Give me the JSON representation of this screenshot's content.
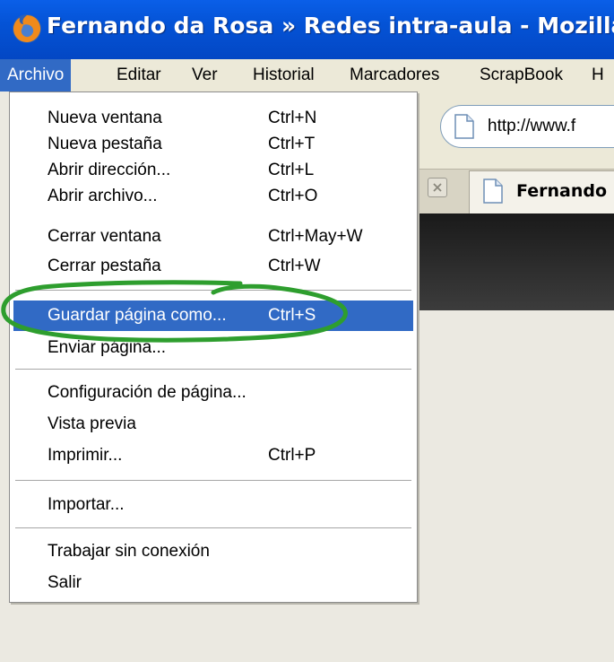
{
  "window": {
    "title": "Fernando da Rosa » Redes intra-aula - Mozilla Firef",
    "app_icon": "firefox-icon"
  },
  "menubar": {
    "items": [
      {
        "label": "Archivo",
        "active": true
      },
      {
        "label": "Editar"
      },
      {
        "label": "Ver"
      },
      {
        "label": "Historial"
      },
      {
        "label": "Marcadores"
      },
      {
        "label": "ScrapBook"
      },
      {
        "label": "H"
      }
    ]
  },
  "toolbar": {
    "url": "http://www.f",
    "page_icon": "page-icon"
  },
  "tabs": [
    {
      "label": "Fernando",
      "close_icon": "close-icon"
    }
  ],
  "archivo_menu": {
    "items": [
      {
        "label": "Nueva ventana",
        "shortcut": "Ctrl+N"
      },
      {
        "label": "Nueva pestaña",
        "shortcut": "Ctrl+T"
      },
      {
        "label": "Abrir dirección...",
        "shortcut": "Ctrl+L"
      },
      {
        "label": "Abrir archivo...",
        "shortcut": "Ctrl+O"
      },
      {
        "label": "Cerrar ventana",
        "shortcut": "Ctrl+May+W"
      },
      {
        "label": "Cerrar pestaña",
        "shortcut": "Ctrl+W"
      },
      {
        "label": "Guardar página como...",
        "shortcut": "Ctrl+S",
        "highlighted": true
      },
      {
        "label": "Enviar página...",
        "shortcut": ""
      },
      {
        "label": "Configuración de página...",
        "shortcut": ""
      },
      {
        "label": "Vista previa",
        "shortcut": ""
      },
      {
        "label": "Imprimir...",
        "shortcut": "Ctrl+P"
      },
      {
        "label": "Importar...",
        "shortcut": ""
      },
      {
        "label": "Trabajar sin conexión",
        "shortcut": ""
      },
      {
        "label": "Salir",
        "shortcut": ""
      }
    ]
  },
  "colors": {
    "titlebar": "#0453d6",
    "highlight": "#316ac5",
    "annotation_circle": "#2e9e2e"
  }
}
